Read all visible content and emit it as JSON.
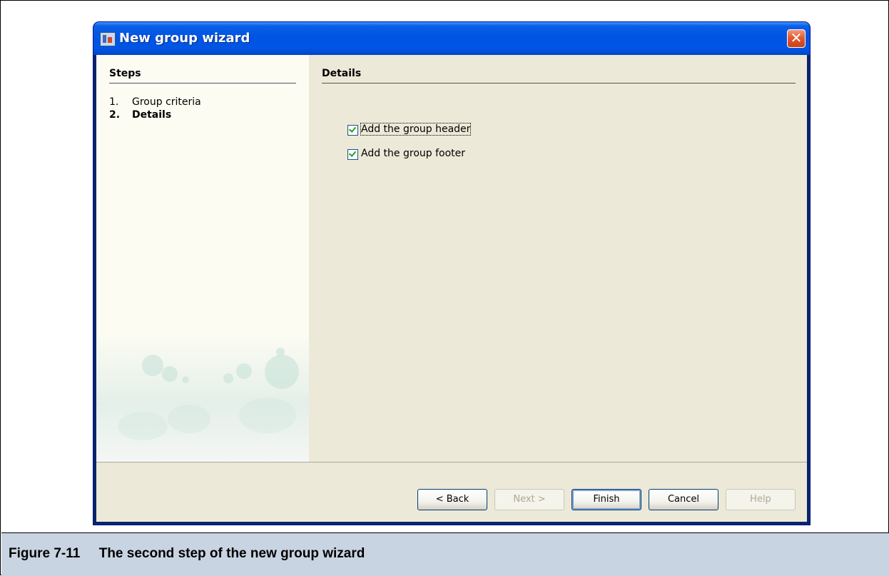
{
  "window": {
    "title": "New group wizard",
    "close_label": "✕"
  },
  "steps_panel": {
    "heading": "Steps",
    "items": [
      {
        "num": "1.",
        "label": "Group criteria"
      },
      {
        "num": "2.",
        "label": "Details"
      }
    ]
  },
  "details_panel": {
    "heading": "Details",
    "options": [
      {
        "label": "Add the group header",
        "checked": true
      },
      {
        "label": "Add the group footer",
        "checked": true
      }
    ]
  },
  "buttons": {
    "back": "< Back",
    "next": "Next >",
    "finish": "Finish",
    "cancel": "Cancel",
    "help": "Help"
  },
  "caption": "Figure 7-11     The second step of the new group wizard"
}
